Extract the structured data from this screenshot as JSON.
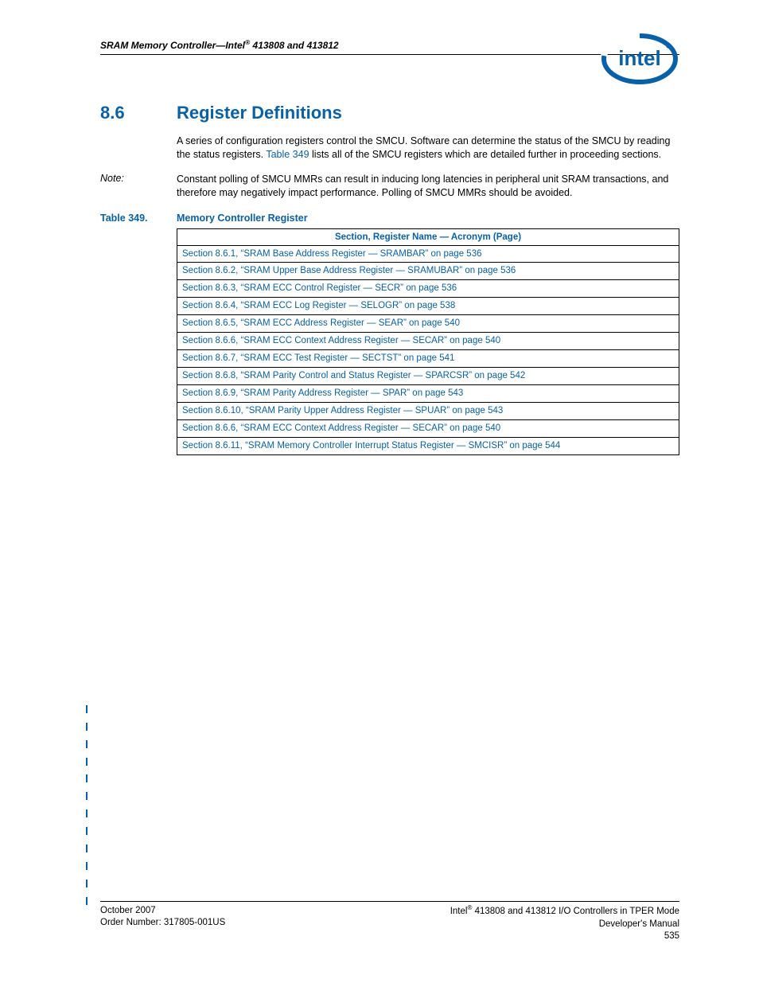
{
  "header": {
    "running_head_html": "SRAM Memory Controller—Intel<sup>®</sup> 413808 and 413812"
  },
  "section": {
    "number": "8.6",
    "title": "Register Definitions",
    "para1_pre": "A series of configuration registers control the SMCU. Software can determine the status of the SMCU by reading the status registers. ",
    "para1_link": "Table 349",
    "para1_post": " lists all of the SMCU registers which are detailed further in proceeding sections.",
    "note_label": "Note:",
    "note_text": "Constant polling of SMCU MMRs can result in inducing long latencies in peripheral unit SRAM transactions, and therefore may negatively impact performance. Polling of SMCU MMRs should be avoided."
  },
  "table": {
    "label": "Table 349.",
    "title": "Memory Controller Register",
    "header": "Section, Register Name — Acronym (Page)",
    "rows": [
      "Section 8.6.1, “SRAM Base Address Register — SRAMBAR” on page 536",
      "Section 8.6.2, “SRAM Upper Base Address Register — SRAMUBAR” on page 536",
      "Section 8.6.3, “SRAM ECC Control Register — SECR” on page 536",
      "Section 8.6.4, “SRAM ECC Log Register — SELOGR” on page 538",
      "Section 8.6.5, “SRAM ECC Address Register — SEAR” on page 540",
      "Section 8.6.6, “SRAM ECC Context Address Register — SECAR” on page 540",
      "Section 8.6.7, “SRAM ECC Test Register — SECTST” on page 541",
      "Section 8.6.8, “SRAM Parity Control and Status Register — SPARCSR” on page 542",
      "Section 8.6.9, “SRAM Parity Address Register — SPAR” on page 543",
      "Section 8.6.10, “SRAM Parity Upper Address Register — SPUAR” on page 543",
      "Section 8.6.6, “SRAM ECC Context Address Register — SECAR” on page 540",
      "Section 8.6.11, “SRAM Memory Controller Interrupt Status Register — SMCISR” on page 544"
    ]
  },
  "footer": {
    "left_line1": "October 2007",
    "left_line2": "Order Number: 317805-001US",
    "right_line1_html": "Intel<sup>®</sup> 413808 and 413812 I/O Controllers in TPER Mode",
    "right_line2": "Developer's Manual",
    "right_line3": "535"
  }
}
